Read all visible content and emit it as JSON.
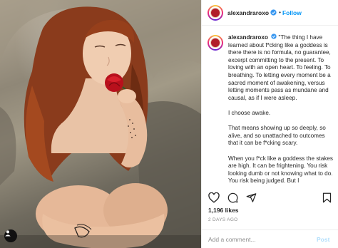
{
  "photo": {
    "alt_subject": "portrait-photo",
    "profile_icon": "user-profile-icon"
  },
  "header": {
    "username": "alexandraroxo",
    "separator": "•",
    "follow_label": "Follow"
  },
  "caption": {
    "username": "alexandraroxo",
    "paragraphs": [
      "\"The thing I have learned about f*cking like a goddess is there there is no formula, no guarantee, excerpt committing to the present. To loving with an open heart. To feeling. To breathing. To letting every moment be a sacred moment of awakening, versus letting moments pass as mundane and causal, as if I were asleep.",
      "I choose awake.",
      "That means showing up so deeply, so alive, and so unattached to outcomes that it can be f*cking scary.",
      "When you f*ck like a goddess the stakes are high. It can be frightening. You risk looking dumb or not knowing what to do. You risk being judged. But I"
    ]
  },
  "actions": {
    "icons": [
      "heart-icon",
      "comment-icon",
      "share-icon",
      "bookmark-icon"
    ]
  },
  "likes": "1,196 likes",
  "date": "2 DAYS AGO",
  "comment": {
    "placeholder": "Add a comment...",
    "post_label": "Post"
  },
  "colors": {
    "link_blue": "#0095f6",
    "post_disabled": "#b2dffc",
    "muted": "#8e8e8e",
    "text": "#262626"
  }
}
